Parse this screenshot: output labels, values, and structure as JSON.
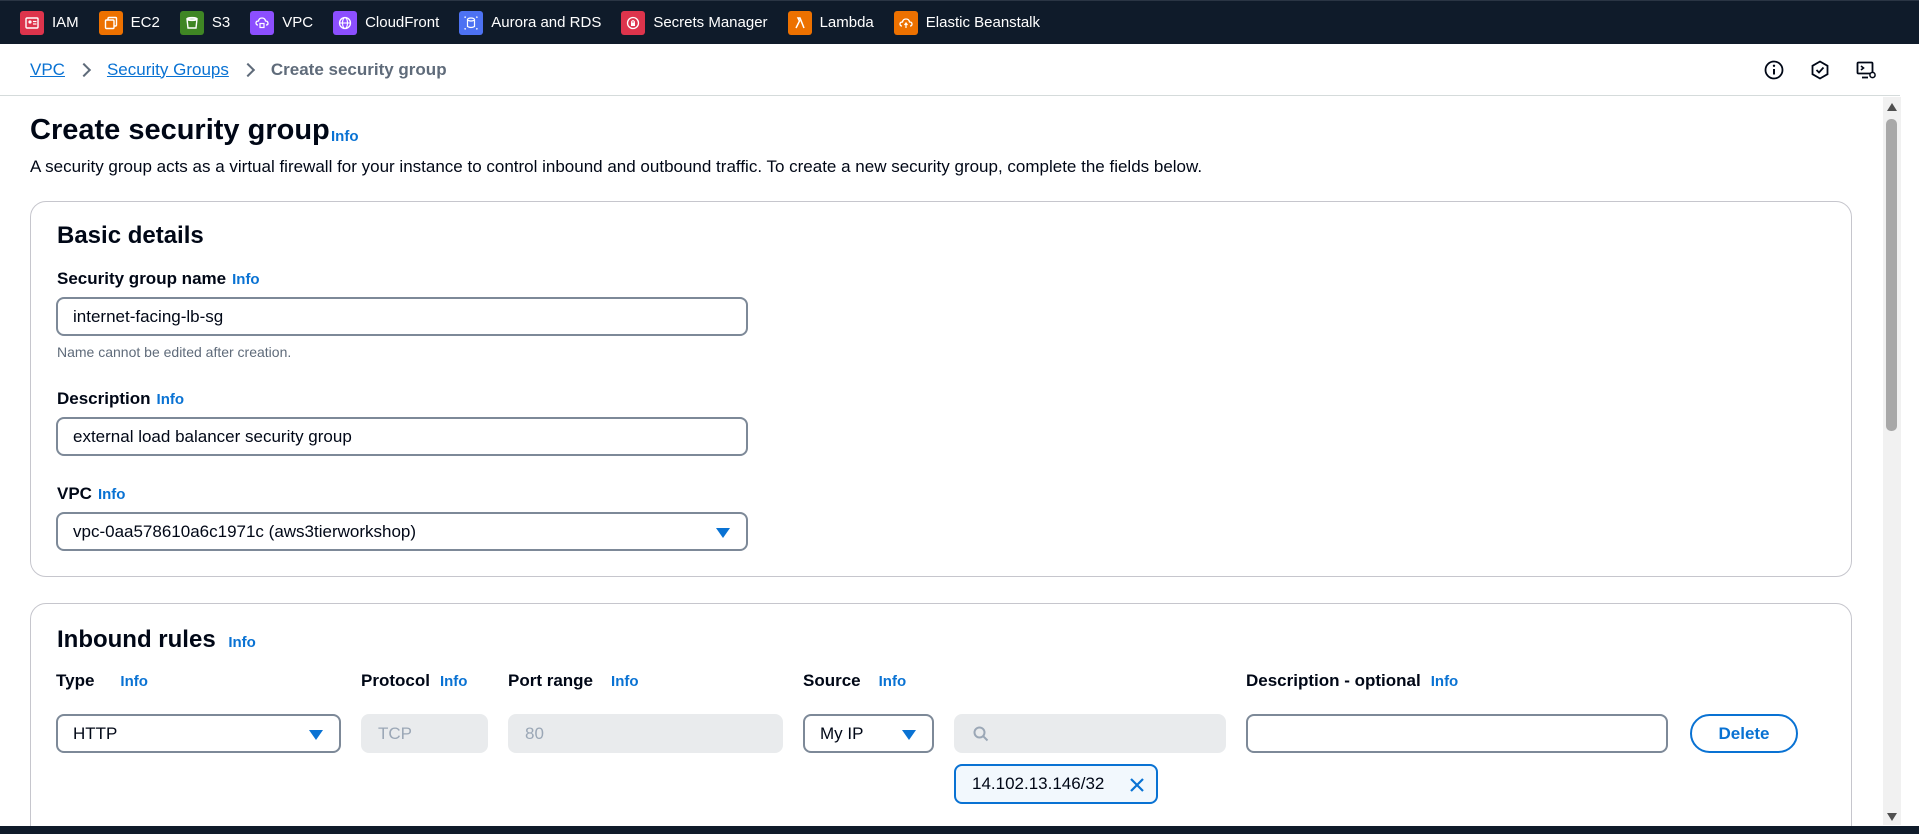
{
  "services": [
    {
      "label": "IAM",
      "color": "#dd344c",
      "icon": "iam-icon"
    },
    {
      "label": "EC2",
      "color": "#ed7100",
      "icon": "ec2-icon"
    },
    {
      "label": "S3",
      "color": "#3f8624",
      "icon": "s3-icon"
    },
    {
      "label": "VPC",
      "color": "#8c4fff",
      "icon": "vpc-icon"
    },
    {
      "label": "CloudFront",
      "color": "#8c4fff",
      "icon": "cloudfront-icon"
    },
    {
      "label": "Aurora and RDS",
      "color": "#4d72f3",
      "icon": "rds-icon"
    },
    {
      "label": "Secrets Manager",
      "color": "#dd344c",
      "icon": "secrets-manager-icon"
    },
    {
      "label": "Lambda",
      "color": "#ed7100",
      "icon": "lambda-icon"
    },
    {
      "label": "Elastic Beanstalk",
      "color": "#ed7100",
      "icon": "elastic-beanstalk-icon"
    }
  ],
  "breadcrumb": {
    "items": [
      "VPC",
      "Security Groups"
    ],
    "current": "Create security group"
  },
  "page": {
    "title": "Create security group",
    "info": "Info",
    "description": "A security group acts as a virtual firewall for your instance to control inbound and outbound traffic. To create a new security group, complete the fields below."
  },
  "basic": {
    "title": "Basic details",
    "name_label": "Security group name",
    "name_value": "internet-facing-lb-sg",
    "name_hint": "Name cannot be edited after creation.",
    "desc_label": "Description",
    "desc_value": "external load balancer security group",
    "vpc_label": "VPC",
    "vpc_value": "vpc-0aa578610a6c1971c (aws3tierworkshop)"
  },
  "inbound": {
    "title": "Inbound rules",
    "columns": {
      "type": "Type",
      "protocol": "Protocol",
      "port": "Port range",
      "source": "Source",
      "description": "Description - optional"
    },
    "rule": {
      "type": "HTTP",
      "protocol": "TCP",
      "port": "80",
      "source": "My IP",
      "source_search": "",
      "cidr": "14.102.13.146/32",
      "description": "",
      "delete_label": "Delete"
    }
  },
  "colors": {
    "accent": "#0972d3",
    "topbar": "#0f1b2a"
  }
}
